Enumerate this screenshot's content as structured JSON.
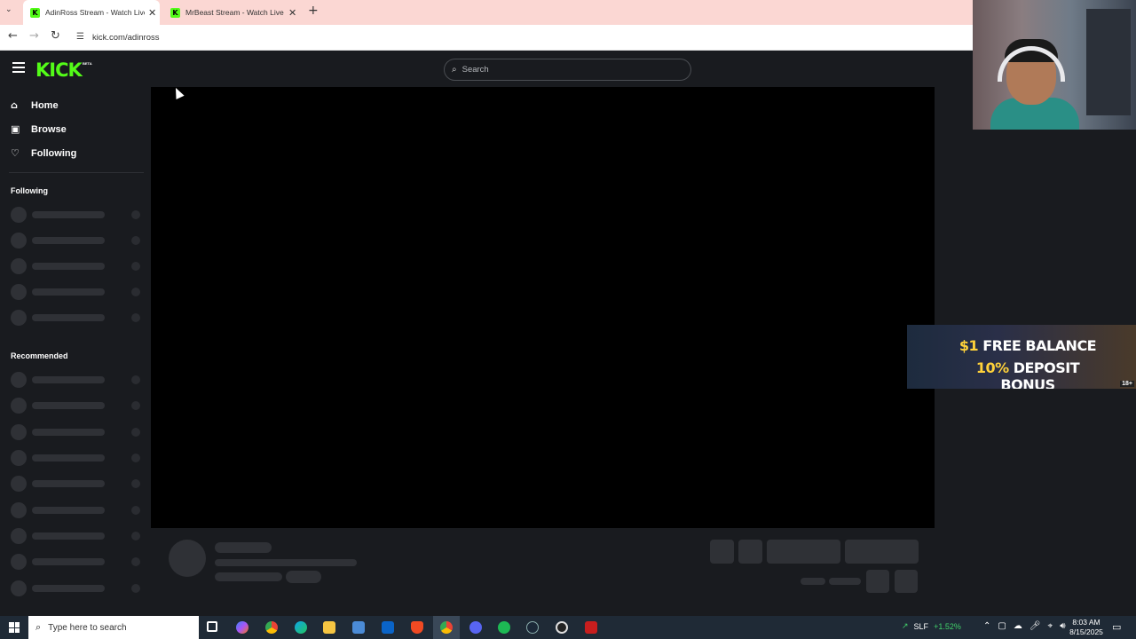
{
  "browser": {
    "tabs": [
      {
        "title": "AdinRoss Stream - Watch Live o",
        "active": true
      },
      {
        "title": "MrBeast Stream - Watch Live o",
        "active": false
      }
    ],
    "tab_close_glyph": "✕",
    "new_tab_glyph": "+",
    "dropdown_glyph": "⌄",
    "url": "kick.com/adinross",
    "nav_icons": [
      "back-icon",
      "forward-icon",
      "reload-icon",
      "site-info-icon"
    ]
  },
  "kick": {
    "logo_text": "KICK",
    "beta_badge": "BETA",
    "search_placeholder": "Search",
    "nav": [
      {
        "label": "Home",
        "icon": "home-icon",
        "glyph": "⌂"
      },
      {
        "label": "Browse",
        "icon": "browse-icon",
        "glyph": "▣"
      },
      {
        "label": "Following",
        "icon": "heart-icon",
        "glyph": "♡"
      }
    ],
    "sections": {
      "following_title": "Following",
      "recommended_title": "Recommended"
    },
    "colors": {
      "brand": "#53fc18",
      "background": "#191b1f",
      "skeleton": "#2f3136"
    }
  },
  "ad": {
    "line1_highlight": "$1",
    "line1_rest": " FREE BALANCE",
    "line2_highlight": "10%",
    "line2_rest": " DEPOSIT BONUS",
    "age_badge": "18+"
  },
  "taskbar": {
    "search_placeholder": "Type here to search",
    "stock_symbol": "SLF",
    "stock_change": "+1.52%",
    "time": "8:03 AM",
    "date": "8/15/2025",
    "apps": [
      "task-view-icon",
      "copilot-icon",
      "chrome-icon",
      "edge-icon",
      "file-explorer-icon",
      "store-icon",
      "outlook-icon",
      "brave-icon",
      "chrome-active-icon",
      "discord-icon",
      "spotify-icon",
      "steam-icon",
      "obs-icon",
      "app-icon"
    ]
  }
}
